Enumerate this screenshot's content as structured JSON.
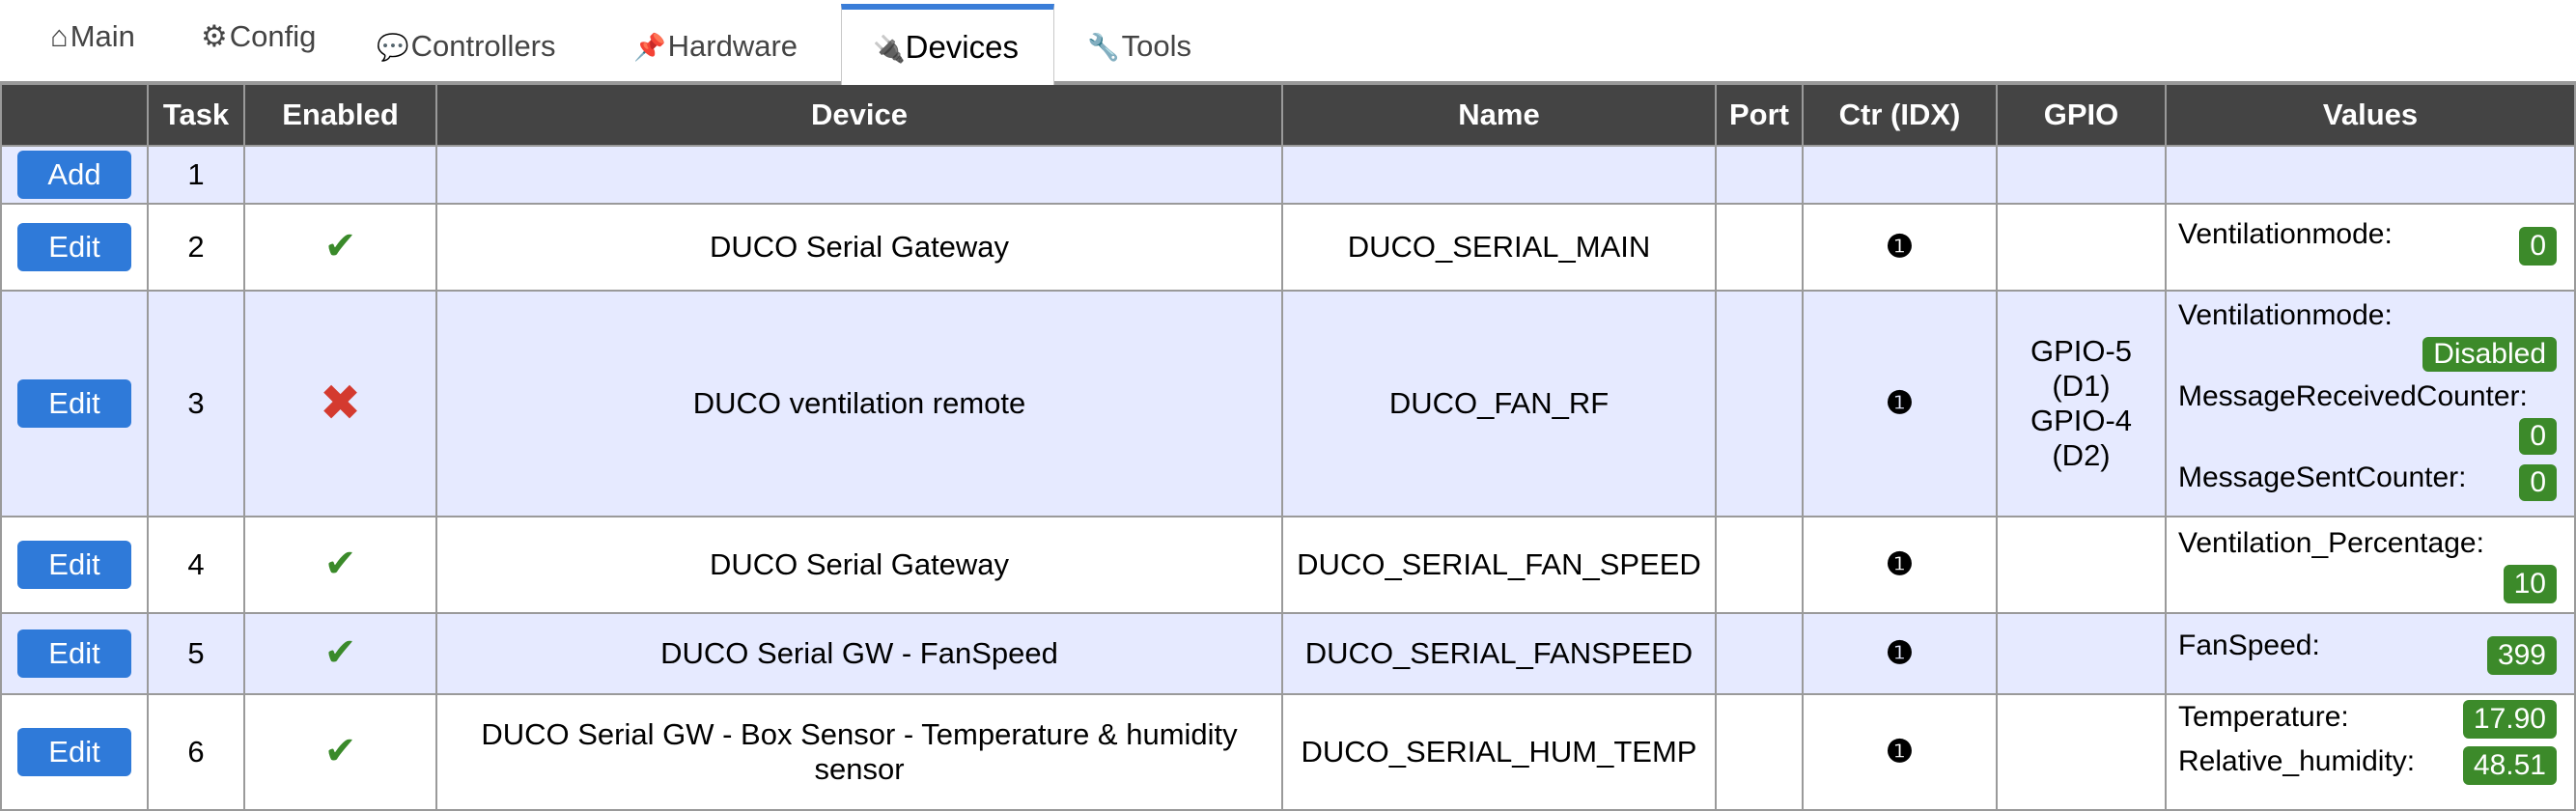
{
  "tabs": [
    {
      "icon": "⌂",
      "label": "Main"
    },
    {
      "icon": "⚙",
      "label": "Config"
    },
    {
      "icon": "💬",
      "label": "Controllers"
    },
    {
      "icon": "📌",
      "label": "Hardware"
    },
    {
      "icon": "🔌",
      "label": "Devices"
    },
    {
      "icon": "🔧",
      "label": "Tools"
    }
  ],
  "table": {
    "headers": [
      "",
      "Task",
      "Enabled",
      "Device",
      "Name",
      "Port",
      "Ctr (IDX)",
      "GPIO",
      "Values"
    ],
    "add_label": "Add",
    "edit_label": "Edit",
    "rows": [
      {
        "task": "1",
        "enabled": "",
        "device": "",
        "name": "",
        "port": "",
        "ctr": "",
        "gpio": "",
        "values": []
      },
      {
        "task": "2",
        "enabled": "✔",
        "device": "DUCO Serial Gateway",
        "name": "DUCO_SERIAL_MAIN",
        "port": "",
        "ctr": "❶",
        "gpio": "",
        "values": [
          {
            "label": "Ventilationmode:",
            "value": "0"
          }
        ]
      },
      {
        "task": "3",
        "enabled": "✖",
        "device": "DUCO ventilation remote",
        "name": "DUCO_FAN_RF",
        "port": "",
        "ctr": "❶",
        "gpio": [
          "GPIO-5",
          "(D1)",
          "GPIO-4",
          "(D2)"
        ],
        "values": [
          {
            "label": "Ventilationmode:",
            "value": "Disabled"
          },
          {
            "label": "MessageReceivedCounter:",
            "value": "0"
          },
          {
            "label": "MessageSentCounter:",
            "value": "0"
          }
        ]
      },
      {
        "task": "4",
        "enabled": "✔",
        "device": "DUCO Serial Gateway",
        "name": "DUCO_SERIAL_FAN_SPEED",
        "port": "",
        "ctr": "❶",
        "gpio": "",
        "values": [
          {
            "label": "Ventilation_Percentage:",
            "value": "10"
          }
        ]
      },
      {
        "task": "5",
        "enabled": "✔",
        "device": "DUCO Serial GW - FanSpeed",
        "name": "DUCO_SERIAL_FANSPEED",
        "port": "",
        "ctr": "❶",
        "gpio": "",
        "values": [
          {
            "label": "FanSpeed:",
            "value": "399"
          }
        ]
      },
      {
        "task": "6",
        "enabled": "✔",
        "device": "DUCO Serial GW - Box Sensor - Temperature & humidity sensor",
        "name": "DUCO_SERIAL_HUM_TEMP",
        "port": "",
        "ctr": "❶",
        "gpio": "",
        "values": [
          {
            "label": "Temperature:",
            "value": "17.90"
          },
          {
            "label": "Relative_humidity:",
            "value": "48.51"
          }
        ]
      }
    ]
  },
  "colors": {
    "header_bg": "#444444",
    "odd_row_bg": "#e6eaff",
    "button_blue": "#2f7ad9",
    "badge_green": "#3c8a2a",
    "check_green": "#3a8a2a",
    "cross_red": "#d43a2f",
    "active_tab_accent": "#3a7dd8"
  }
}
